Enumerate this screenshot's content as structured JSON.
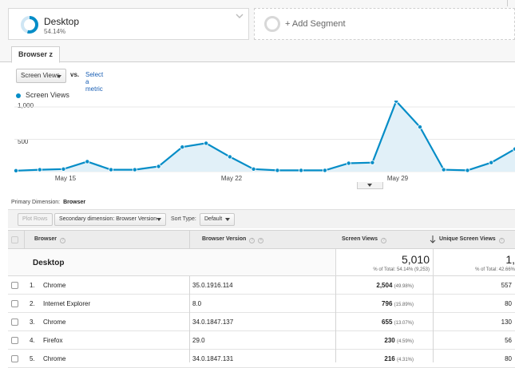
{
  "segments": {
    "active": {
      "name": "Desktop",
      "percent": "54.14%"
    },
    "add_label": "+ Add Segment"
  },
  "tab": {
    "label": "Browser z"
  },
  "metric": {
    "selected": "Screen Views",
    "vs": "vs.",
    "select_metric": "Select a metric"
  },
  "chart_data": {
    "type": "line",
    "series": [
      {
        "name": "Screen Views",
        "values": [
          15,
          30,
          40,
          155,
          30,
          30,
          80,
          380,
          440,
          230,
          40,
          20,
          20,
          20,
          130,
          140,
          1090,
          690,
          30,
          20,
          140,
          350
        ]
      }
    ],
    "y_ticks": [
      "1,000",
      "500"
    ],
    "x_ticks": [
      "May 15",
      "May 22",
      "May 29"
    ],
    "ylim": [
      0,
      1300
    ],
    "color": "#058dc7",
    "fill": "#e1f0f8",
    "grid": true
  },
  "primary_dimension": {
    "label": "Primary Dimension:",
    "value": "Browser"
  },
  "toolbar": {
    "plot_rows": "Plot Rows",
    "secondary_dimension": "Secondary dimension: Browser Version",
    "sort_type_label": "Sort Type:",
    "sort_type_value": "Default"
  },
  "table": {
    "headers": [
      "Browser",
      "Browser Version",
      "Screen Views",
      "Unique Screen Views"
    ],
    "summary": {
      "label": "Desktop",
      "screen_views": "5,010",
      "screen_views_total": "% of Total: 54.14% (9,253)",
      "unique_views": "1,",
      "unique_views_total": "% of Total: 42.66%"
    },
    "rows": [
      {
        "index": "1.",
        "browser": "Chrome",
        "version": "35.0.1916.114",
        "views": "2,504",
        "views_pct": "(49.98%)",
        "unique": "557"
      },
      {
        "index": "2.",
        "browser": "Internet Explorer",
        "version": "8.0",
        "views": "796",
        "views_pct": "(15.89%)",
        "unique": "80"
      },
      {
        "index": "3.",
        "browser": "Chrome",
        "version": "34.0.1847.137",
        "views": "655",
        "views_pct": "(13.07%)",
        "unique": "130"
      },
      {
        "index": "4.",
        "browser": "Firefox",
        "version": "29.0",
        "views": "230",
        "views_pct": "(4.59%)",
        "unique": "56"
      },
      {
        "index": "5.",
        "browser": "Chrome",
        "version": "34.0.1847.131",
        "views": "216",
        "views_pct": "(4.31%)",
        "unique": "80"
      }
    ]
  }
}
